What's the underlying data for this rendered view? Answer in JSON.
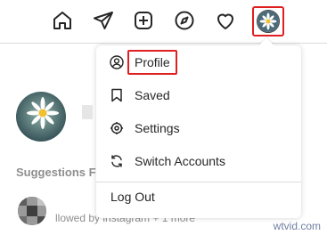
{
  "menu": {
    "items": [
      {
        "label": "Profile",
        "icon": "profile-icon"
      },
      {
        "label": "Saved",
        "icon": "bookmark-icon"
      },
      {
        "label": "Settings",
        "icon": "gear-icon"
      },
      {
        "label": "Switch Accounts",
        "icon": "switch-accounts-icon"
      }
    ],
    "logout_label": "Log Out"
  },
  "background": {
    "suggestions_heading": "Suggestions F",
    "suggestion_subtext": "llowed by instagram + 1 more"
  },
  "nav": {
    "icons": [
      "home-icon",
      "direct-message-icon",
      "new-post-icon",
      "explore-icon",
      "activity-heart-icon",
      "avatar"
    ]
  },
  "colors": {
    "highlight": "#e02020",
    "text": "#262626",
    "border": "#dbdbdb",
    "muted": "#8e8e8e"
  },
  "watermark": "wtvid.com"
}
